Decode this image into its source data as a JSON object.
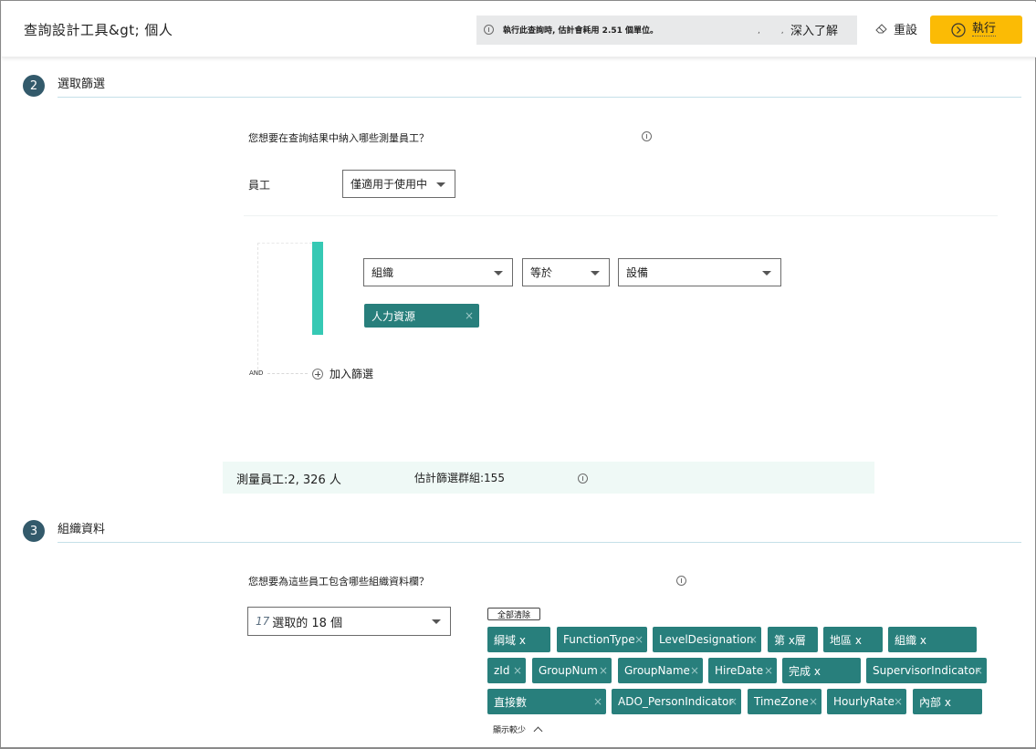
{
  "header": {
    "title": "查詢設計工具&gt;  個人",
    "notice_text": "執行此查詢時, 估計會耗用 2.51 個單位。",
    "notice_dots": ", ,",
    "learn_more": "深入了解",
    "reset_label": "重設",
    "run_label": "執行",
    "run_color": "#fbbb05"
  },
  "section2": {
    "step": "2",
    "title": "選取篩選",
    "question": "您想要在查詢結果中納入哪些測量員工？",
    "employee_label": "員工",
    "employee_select": "僅適用于使用中",
    "filter": {
      "attribute": "組織",
      "operator": "等於",
      "value": "設備",
      "selected_values": [
        {
          "label": "人力資源"
        }
      ]
    },
    "and_label": "AND",
    "add_filter": "加入篩選",
    "summary": {
      "measured_employees": "測量員工:2, 326 人",
      "estimated_groups": "估計篩選群組:155"
    }
  },
  "section3": {
    "step": "3",
    "title": "組織資料",
    "question": "您想要為這些員工包含哪些組織資料欄？",
    "select_count": "17",
    "select_text": "選取的 18 個",
    "clear_all": "全部清除",
    "tags": [
      {
        "label": "綱域 x",
        "close": ""
      },
      {
        "label": "FunctionType",
        "close": "×"
      },
      {
        "label": "LevelDesignation",
        "close": "×"
      },
      {
        "label": "第 x層",
        "close": ""
      },
      {
        "label": "地區 x",
        "close": ""
      },
      {
        "label": "組織 x",
        "close": ""
      },
      {
        "label": "zId",
        "close": "×"
      },
      {
        "label": "GroupNum",
        "close": "×"
      },
      {
        "label": "GroupName",
        "close": "×"
      },
      {
        "label": "HireDate",
        "close": "×"
      },
      {
        "label": "完成 x",
        "close": ""
      },
      {
        "label": "SupervisorIndicator",
        "close": "×"
      },
      {
        "label": "直接數",
        "close": "×"
      },
      {
        "label": "ADO_PersonIndicator",
        "close": "×"
      },
      {
        "label": "TimeZone",
        "close": "×"
      },
      {
        "label": "HourlyRate",
        "close": "×"
      },
      {
        "label": "內部 x",
        "close": ""
      }
    ],
    "show_less": "顯示較少"
  },
  "colors": {
    "step_badge": "#335a6b",
    "tag_bg": "#287f7c",
    "filter_bar": "#36c9b4",
    "summary_bg": "#eff9f6"
  }
}
